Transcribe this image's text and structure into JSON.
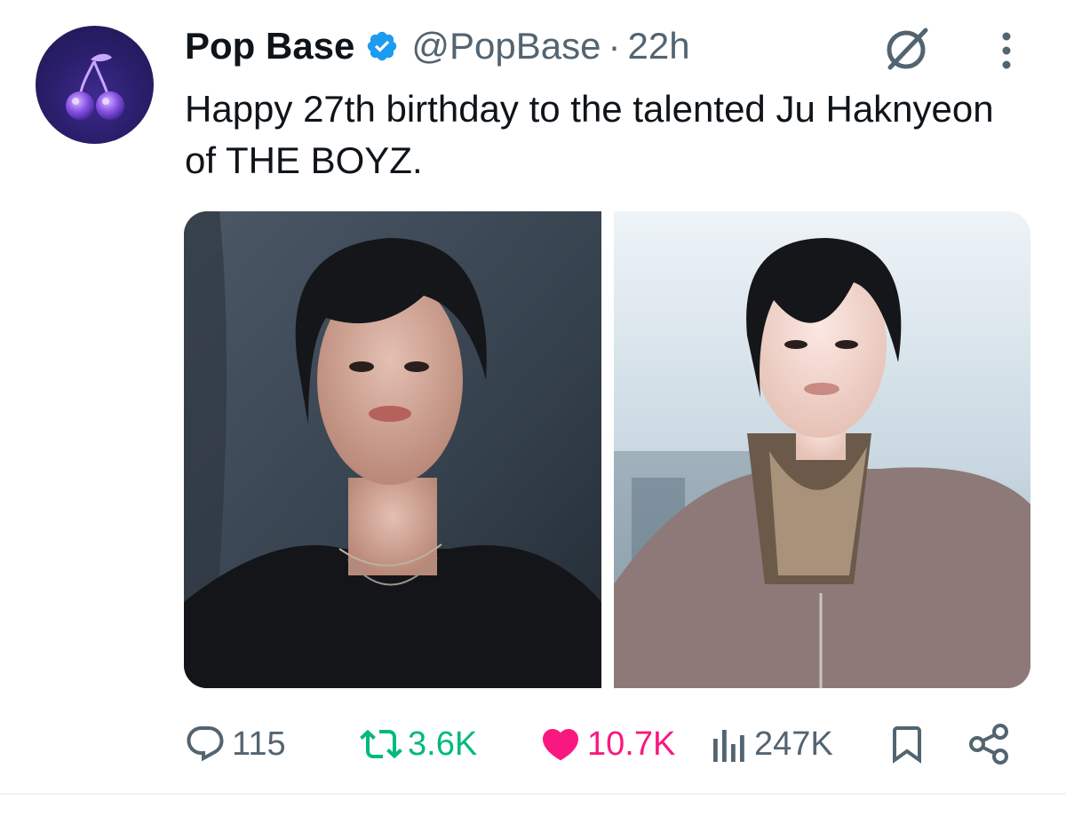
{
  "tweet": {
    "author": {
      "name": "Pop Base",
      "handle": "@PopBase",
      "verified": true,
      "avatar_icon": "cherry-icon"
    },
    "separator": "·",
    "time": "22h",
    "text": "Happy 27th birthday to the talented Ju Haknyeon of THE BOYZ.",
    "media": [
      {
        "kind": "photo",
        "icon": "portrait-photo-dark"
      },
      {
        "kind": "photo",
        "icon": "portrait-photo-light"
      }
    ],
    "actions": {
      "reply": {
        "icon": "reply-icon",
        "count": "115"
      },
      "retweet": {
        "icon": "retweet-icon",
        "count": "3.6K"
      },
      "like": {
        "icon": "heart-icon",
        "count": "10.7K",
        "liked": true
      },
      "views": {
        "icon": "views-icon",
        "count": "247K"
      },
      "bookmark": {
        "icon": "bookmark-icon"
      },
      "share": {
        "icon": "share-icon"
      }
    }
  },
  "colors": {
    "text": "#0f1419",
    "secondary": "#536471",
    "verified": "#1d9bf0",
    "retweet": "#00ba7c",
    "like": "#f91880"
  }
}
